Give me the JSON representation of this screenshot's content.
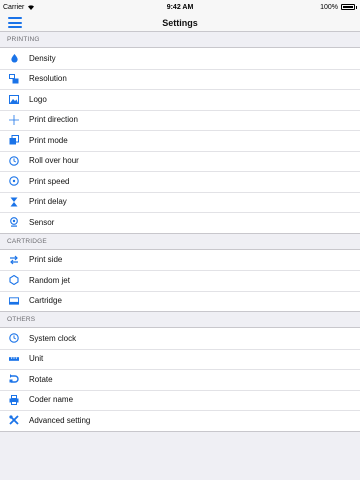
{
  "status": {
    "carrier": "Carrier",
    "time": "9:42 AM",
    "battery": "100%"
  },
  "nav": {
    "title": "Settings"
  },
  "accent": "#1a73e8",
  "sections": [
    {
      "header": "PRINTING",
      "items": [
        {
          "label": "Density",
          "icon": "drop-icon"
        },
        {
          "label": "Resolution",
          "icon": "resolution-icon"
        },
        {
          "label": "Logo",
          "icon": "image-icon"
        },
        {
          "label": "Print direction",
          "icon": "direction-icon"
        },
        {
          "label": "Print mode",
          "icon": "mode-icon"
        },
        {
          "label": "Roll over hour",
          "icon": "clock-icon"
        },
        {
          "label": "Print speed",
          "icon": "speed-icon"
        },
        {
          "label": "Print delay",
          "icon": "hourglass-icon"
        },
        {
          "label": "Sensor",
          "icon": "sensor-icon"
        }
      ]
    },
    {
      "header": "CARTRIDGE",
      "items": [
        {
          "label": "Print side",
          "icon": "swap-icon"
        },
        {
          "label": "Random jet",
          "icon": "jet-icon"
        },
        {
          "label": "Cartridge",
          "icon": "cartridge-icon"
        }
      ]
    },
    {
      "header": "OTHERS",
      "items": [
        {
          "label": "System clock",
          "icon": "clock-icon"
        },
        {
          "label": "Unit",
          "icon": "ruler-icon"
        },
        {
          "label": "Rotate",
          "icon": "rotate-icon"
        },
        {
          "label": "Coder name",
          "icon": "printer-icon"
        },
        {
          "label": "Advanced setting",
          "icon": "tools-icon"
        }
      ]
    }
  ]
}
